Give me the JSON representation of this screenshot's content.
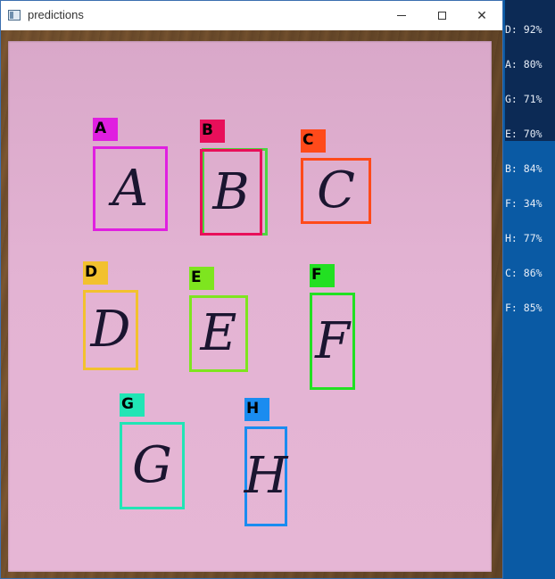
{
  "window": {
    "title": "predictions",
    "minimize_label": "—",
    "maximize_label": "☐",
    "close_label": "✕"
  },
  "terminal": {
    "lines": [
      "D: 92%",
      "A: 80%",
      "G: 71%",
      "E: 70%",
      "B: 84%",
      "F: 34%",
      "H: 77%",
      "C: 86%",
      "F: 85%"
    ]
  },
  "detections": [
    {
      "label": "A",
      "glyph": "A",
      "color": "#e01fe0"
    },
    {
      "label": "B",
      "glyph": "B",
      "color": "#e80f5a"
    },
    {
      "label": "C",
      "glyph": "C",
      "color": "#ff4a1a"
    },
    {
      "label": "D",
      "glyph": "D",
      "color": "#f2c12e"
    },
    {
      "label": "E",
      "glyph": "E",
      "color": "#7ee51f"
    },
    {
      "label": "F",
      "glyph": "F",
      "color": "#22e022"
    },
    {
      "label": "G",
      "glyph": "G",
      "color": "#21e5b5"
    },
    {
      "label": "H",
      "glyph": "H",
      "color": "#1a8cf0"
    }
  ]
}
